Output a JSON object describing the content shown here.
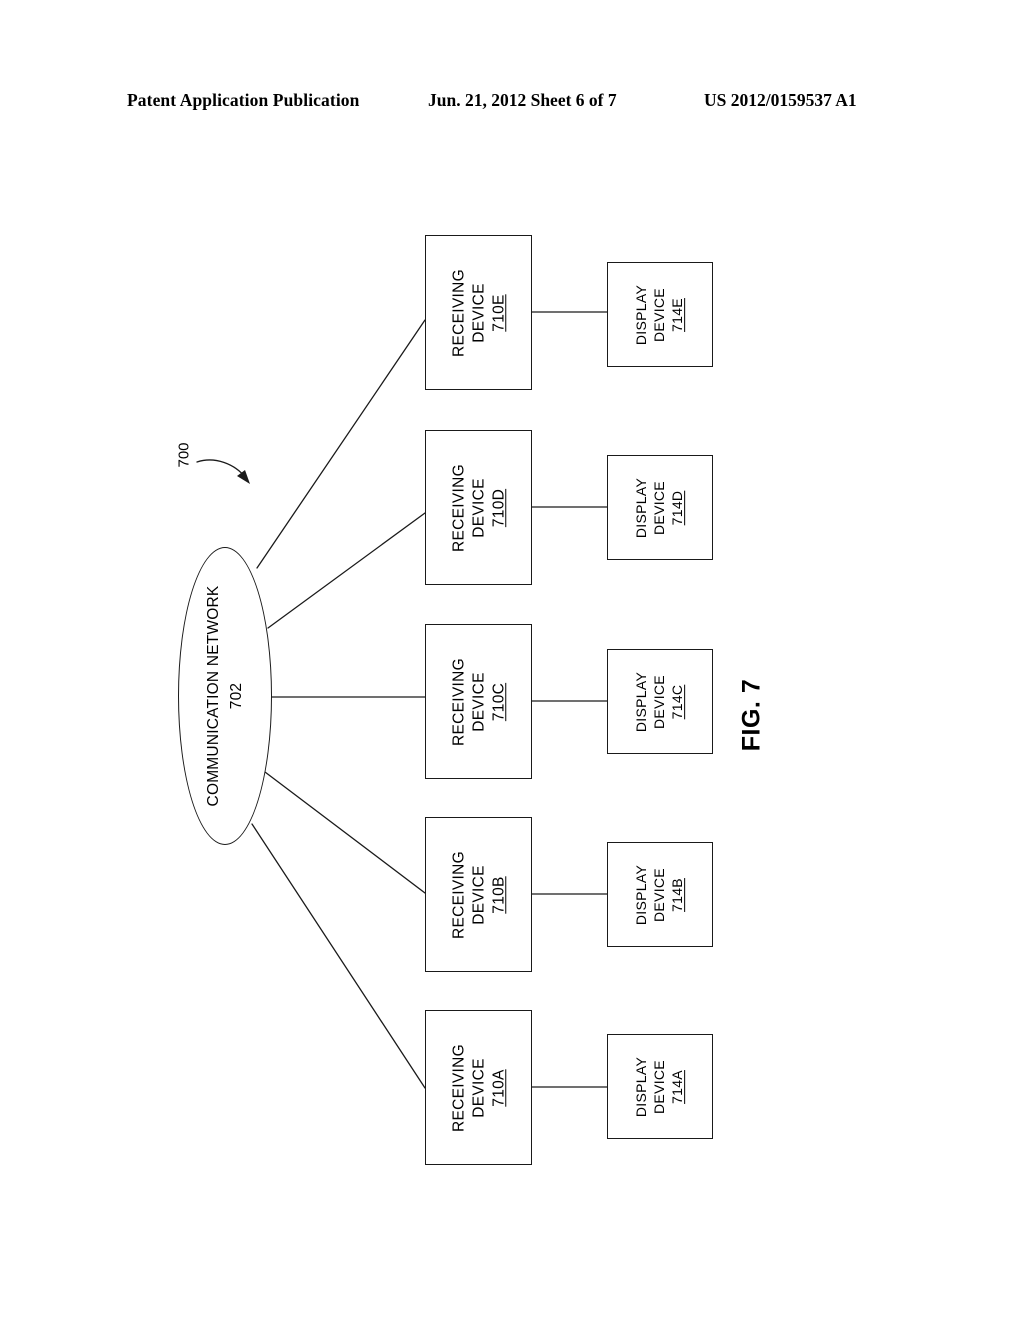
{
  "header": {
    "publication": "Patent Application Publication",
    "date_sheet": "Jun. 21, 2012  Sheet 6 of 7",
    "patent_number": "US 2012/0159537 A1"
  },
  "figure": {
    "caption": "FIG. 7",
    "system_ref": "700"
  },
  "network": {
    "label": "COMMUNICATION NETWORK",
    "ref": "702"
  },
  "rows": [
    {
      "receiving": {
        "line1": "RECEIVING",
        "line2": "DEVICE",
        "ref": "710E"
      },
      "display": {
        "line1": "DISPLAY",
        "line2": "DEVICE",
        "ref": "714E"
      }
    },
    {
      "receiving": {
        "line1": "RECEIVING",
        "line2": "DEVICE",
        "ref": "710D"
      },
      "display": {
        "line1": "DISPLAY",
        "line2": "DEVICE",
        "ref": "714D"
      }
    },
    {
      "receiving": {
        "line1": "RECEIVING",
        "line2": "DEVICE",
        "ref": "710C"
      },
      "display": {
        "line1": "DISPLAY",
        "line2": "DEVICE",
        "ref": "714C"
      }
    },
    {
      "receiving": {
        "line1": "RECEIVING",
        "line2": "DEVICE",
        "ref": "710B"
      },
      "display": {
        "line1": "DISPLAY",
        "line2": "DEVICE",
        "ref": "714B"
      }
    },
    {
      "receiving": {
        "line1": "RECEIVING",
        "line2": "DEVICE",
        "ref": "710A"
      },
      "display": {
        "line1": "DISPLAY",
        "line2": "DEVICE",
        "ref": "714A"
      }
    }
  ],
  "colors": {
    "ink": "#1a1a1a",
    "paper": "#ffffff"
  }
}
